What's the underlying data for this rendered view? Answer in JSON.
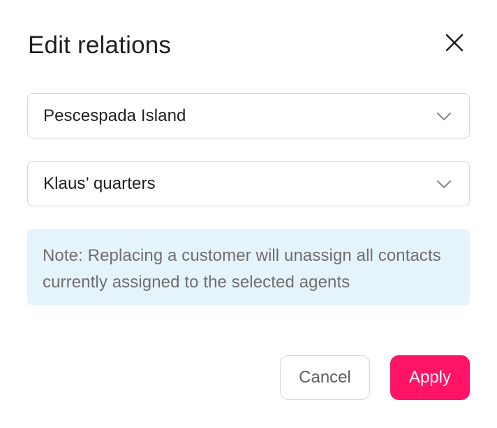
{
  "dialog": {
    "title": "Edit relations",
    "close_icon": "close-icon"
  },
  "selects": [
    {
      "value": "Pescespada Island",
      "icon": "chevron-down-icon"
    },
    {
      "value": "Klaus’ quarters",
      "icon": "chevron-down-icon"
    }
  ],
  "note": {
    "text": "Note: Replacing a customer will unassign all contacts currently assigned to the selected agents"
  },
  "footer": {
    "cancel_label": "Cancel",
    "apply_label": "Apply"
  },
  "colors": {
    "accent": "#ff1466",
    "note_background": "#e5f3fb",
    "border": "#d6d6d6"
  }
}
